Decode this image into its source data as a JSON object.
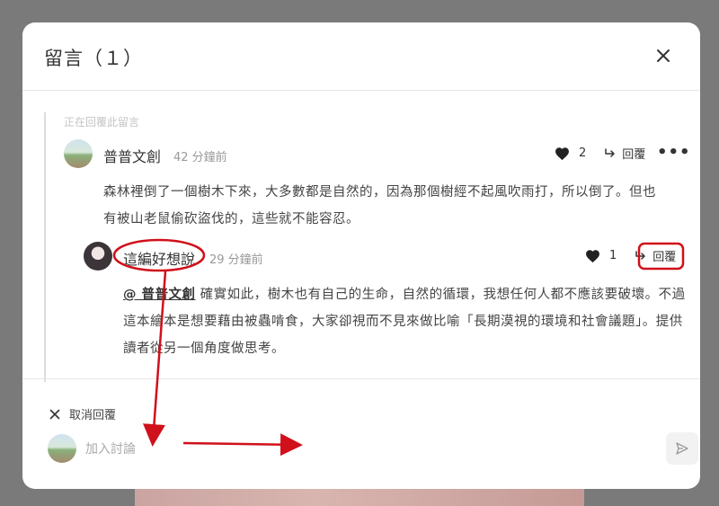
{
  "modal": {
    "title": "留言（１）",
    "context_label": "正在回覆此留言"
  },
  "parent_comment": {
    "author": "普普文創",
    "time": "42 分鐘前",
    "likes": "2",
    "reply_label": "回覆",
    "more": "•••",
    "text": "森林裡倒了一個樹木下來，大多數都是自然的，因為那個樹經不起風吹雨打，所以倒了。但也有被山老鼠偷砍盜伐的，這些就不能容忍。"
  },
  "reply_comment": {
    "author": "這編好想說",
    "time": "29 分鐘前",
    "likes": "1",
    "reply_label": "回覆",
    "mention": "@ 普普文創",
    "text": " 確實如此，樹木也有自己的生命，自然的循環，我想任何人都不應該要破壞。不過這本繪本是想要藉由被蟲啃食，大家卻視而不見來做比喻「長期漠視的環境和社會議題」。提供讀者從另一個角度做思考。"
  },
  "composer": {
    "cancel_label": "取消回覆",
    "placeholder": "加入討論"
  },
  "colors": {
    "annotation_red": "#d0101a",
    "overlay": "#7a7a7a"
  },
  "icons": {
    "close": "close-icon",
    "heart": "heart-icon",
    "reply": "reply-arrow-icon",
    "send": "send-icon",
    "cancel": "x-icon"
  }
}
